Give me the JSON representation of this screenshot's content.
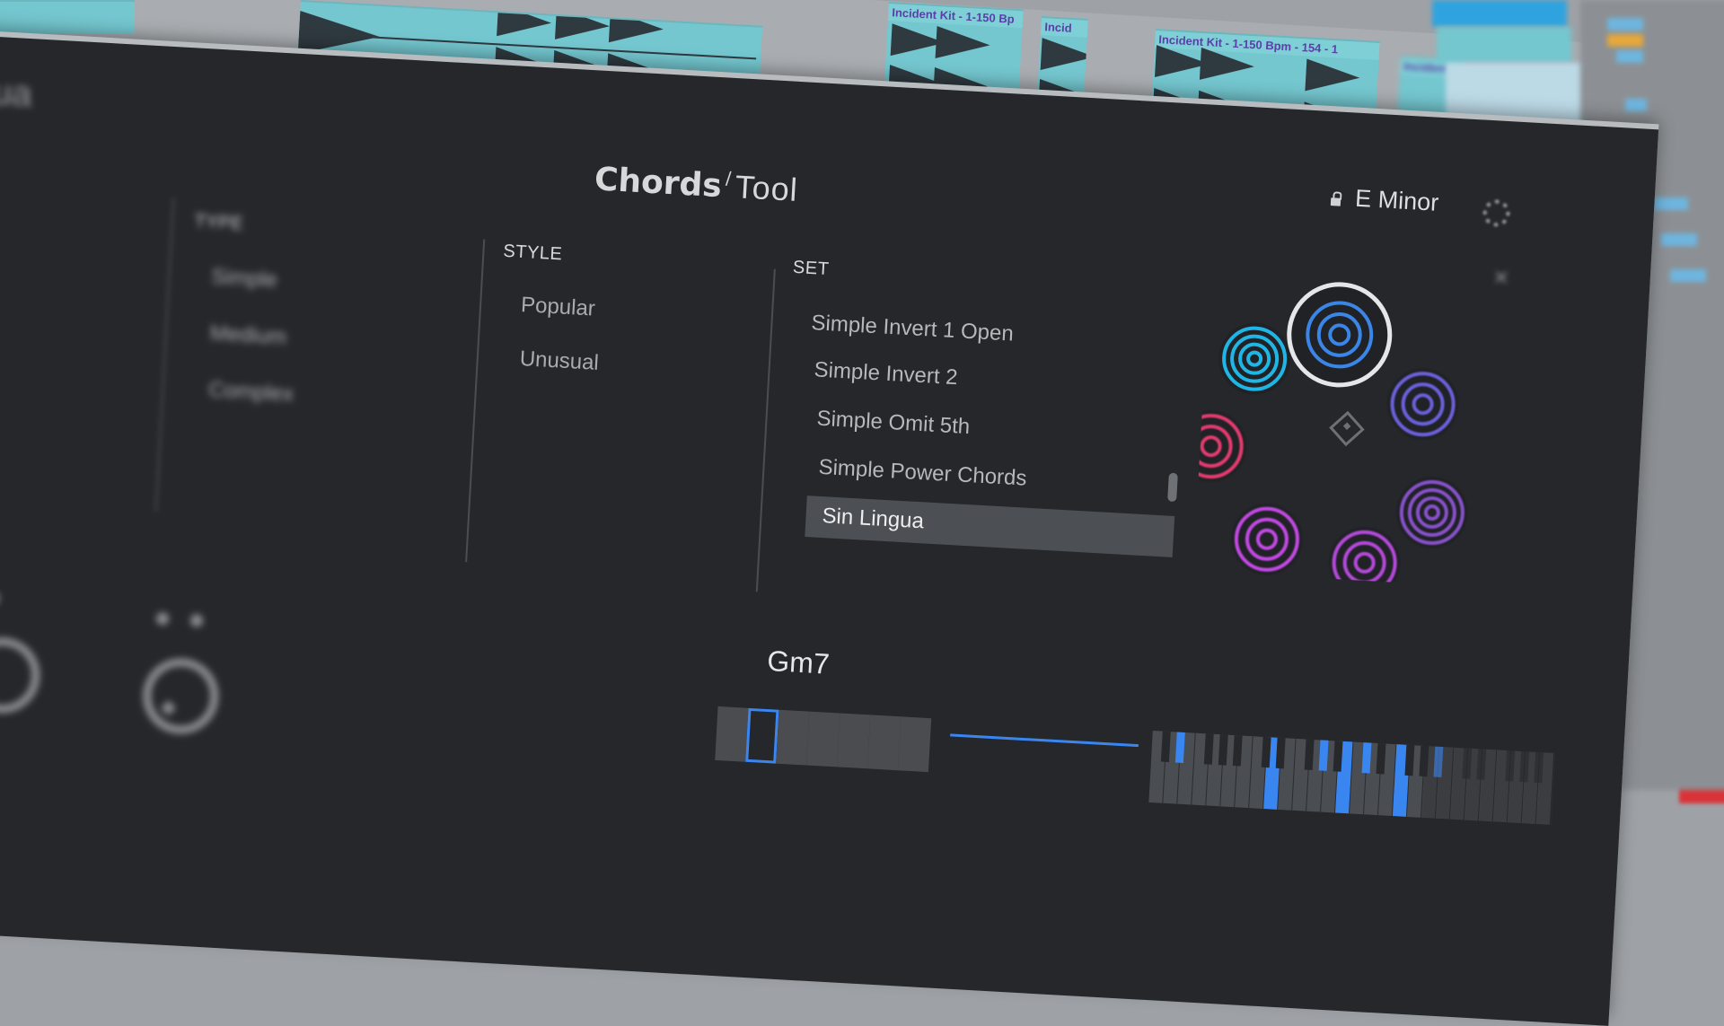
{
  "daw": {
    "clips": [
      {
        "label": "Incident Kit - 1-150 Bp"
      },
      {
        "label": "Incid"
      },
      {
        "label": "Incident Kit - 1-150 Bpm - 154 - 1"
      },
      {
        "label": "Incident"
      }
    ]
  },
  "plugin": {
    "title_bold": "Chords",
    "title_tick": "/",
    "title_light": "Tool",
    "library_title_fragment": "ngua",
    "key": {
      "label": "E Minor",
      "locked": true
    },
    "type": {
      "heading": "TYPE",
      "items": [
        "Simple",
        "Medium",
        "Complex"
      ]
    },
    "style": {
      "heading": "STYLE",
      "items": [
        "Popular",
        "Unusual"
      ]
    },
    "set": {
      "heading": "SET",
      "items": [
        "Simple Invert 1 Open",
        "Simple Invert 2",
        "Simple Omit 5th",
        "Simple Power Chords"
      ],
      "selected": "Sin Lingua"
    },
    "wheel": {
      "pads": [
        {
          "name": "pad-cyan",
          "color": "#1fb6e6",
          "rings": 4,
          "selected": false
        },
        {
          "name": "pad-blue",
          "color": "#3a86e6",
          "rings": 3,
          "selected": true
        },
        {
          "name": "pad-indigo",
          "color": "#6a5fd8",
          "rings": 3,
          "selected": false
        },
        {
          "name": "pad-violet",
          "color": "#8650c8",
          "rings": 4,
          "selected": false
        },
        {
          "name": "pad-magenta",
          "color": "#b348d8",
          "rings": 3,
          "selected": false
        },
        {
          "name": "pad-purple",
          "color": "#c048e0",
          "rings": 3,
          "selected": false
        },
        {
          "name": "pad-pink",
          "color": "#e23a6e",
          "rings": 3,
          "selected": false
        }
      ],
      "selected_ring_color": "#e4e6e8"
    },
    "current_chord": "Gm7",
    "chord_slots": {
      "count": 7,
      "active_index": 1
    },
    "accent_color": "#3a86f0"
  }
}
